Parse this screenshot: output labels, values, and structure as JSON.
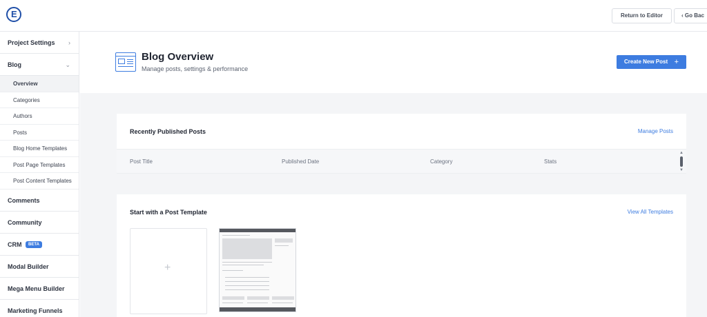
{
  "topbar": {
    "logo_letter": "E",
    "return_label": "Return to Editor",
    "goback_label": "‹  Go Bac"
  },
  "sidebar": {
    "project_settings": "Project Settings",
    "blog": "Blog",
    "blog_items": [
      "Overview",
      "Categories",
      "Authors",
      "Posts",
      "Blog Home Templates",
      "Post Page Templates",
      "Post Content Templates"
    ],
    "comments": "Comments",
    "community": "Community",
    "crm": "CRM",
    "crm_badge": "BETA",
    "modal_builder": "Modal Builder",
    "mega_menu_builder": "Mega Menu Builder",
    "marketing_funnels": "Marketing Funnels",
    "active_item": "Overview"
  },
  "header": {
    "title": "Blog Overview",
    "subtitle": "Manage posts, settings & performance",
    "create_label": "Create New Post",
    "create_plus": "+"
  },
  "recent": {
    "title": "Recently Published Posts",
    "link": "Manage Posts",
    "columns": [
      "Post Title",
      "Published Date",
      "Category",
      "Stats"
    ]
  },
  "templates": {
    "title": "Start with a Post Template",
    "link": "View All Templates",
    "blank_plus": "+"
  },
  "colors": {
    "accent": "#3d7ce0",
    "badge": "#3d7ce0"
  }
}
